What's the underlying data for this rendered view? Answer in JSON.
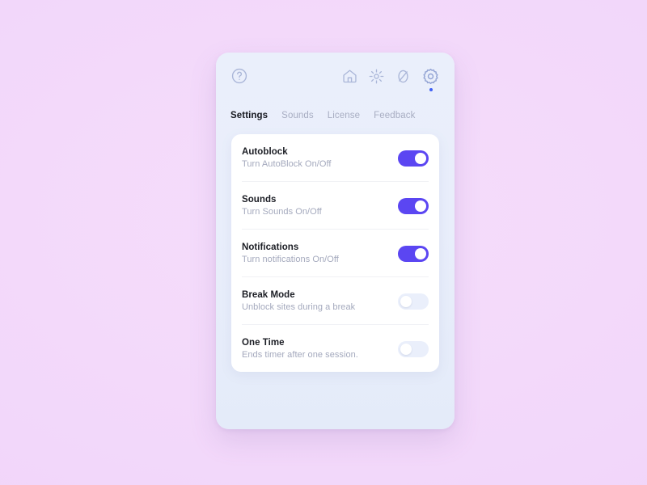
{
  "theme": {
    "page_background": "#f3daf9",
    "window_background": "#eaeffb",
    "card_background": "#ffffff",
    "accent": "#5b46f2",
    "dot_accent": "#3f60f5",
    "icon_color": "#aab6d8",
    "title_color": "#1b1d24",
    "subtitle_color": "#a4a9bd",
    "tab_inactive_color": "#a8adc2",
    "toggle_off_color": "#eaeffb"
  },
  "topbar": {
    "help_icon": "question-circle-icon",
    "actions": [
      {
        "icon": "home-icon",
        "name": "home",
        "active": false
      },
      {
        "icon": "focus-burst-icon",
        "name": "focus",
        "active": false
      },
      {
        "icon": "block-slash-icon",
        "name": "block",
        "active": false
      },
      {
        "icon": "gear-icon",
        "name": "settings",
        "active": true
      }
    ]
  },
  "tabs": [
    {
      "label": "Settings",
      "active": true
    },
    {
      "label": "Sounds",
      "active": false
    },
    {
      "label": "License",
      "active": false
    },
    {
      "label": "Feedback",
      "active": false
    }
  ],
  "settings": [
    {
      "title": "Autoblock",
      "subtitle": "Turn AutoBlock On/Off",
      "enabled": true
    },
    {
      "title": "Sounds",
      "subtitle": "Turn Sounds On/Off",
      "enabled": true
    },
    {
      "title": "Notifications",
      "subtitle": "Turn notifications On/Off",
      "enabled": true
    },
    {
      "title": "Break Mode",
      "subtitle": "Unblock sites during a break",
      "enabled": false
    },
    {
      "title": "One Time",
      "subtitle": "Ends timer after one session.",
      "enabled": false
    }
  ]
}
